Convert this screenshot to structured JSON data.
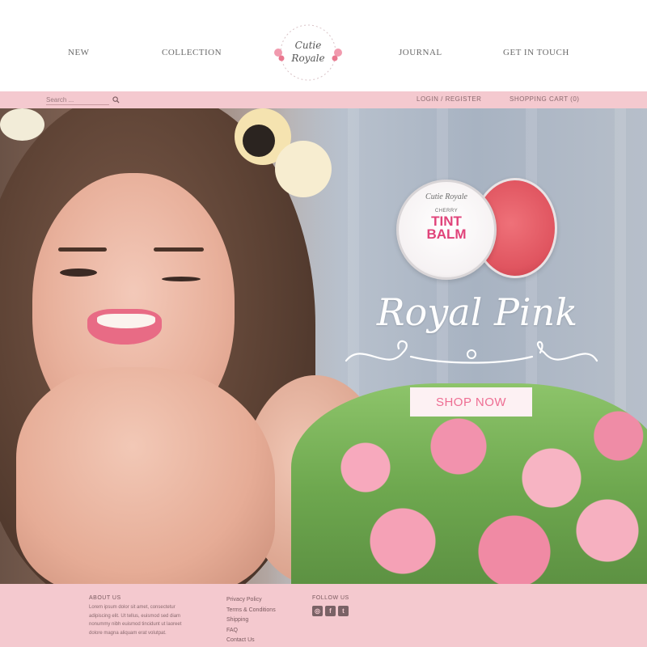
{
  "header": {
    "nav": {
      "new": "NEW",
      "collection": "COLLECTION",
      "journal": "JOURNAL",
      "contact": "GET IN TOUCH"
    },
    "logo_text": "Cutie Royale"
  },
  "utility_bar": {
    "search_placeholder": "Search ...",
    "login": "LOGIN / REGISTER",
    "cart": "SHOPPING CART (0)"
  },
  "hero": {
    "product_brand": "Cutie Royale",
    "product_subtitle": "CHERRY",
    "product_name_line1": "TINT",
    "product_name_line2": "BALM",
    "headline": "Royal Pink",
    "cta": "SHOP NOW"
  },
  "footer": {
    "about_title": "ABOUT US",
    "about_text": "Lorem ipsum dolor sit amet, consectetur adipiscing elit. Ut tellus, euismod sed diam nonummy nibh euismod tincidunt ut laoreet dolore magna aliquam erat volutpat.",
    "links": [
      "Privacy Policy",
      "Terms & Conditions",
      "Shipping",
      "FAQ",
      "Contact Us"
    ],
    "follow_title": "FOLLOW US",
    "social_icons": [
      "instagram-icon",
      "facebook-icon",
      "twitter-icon"
    ]
  },
  "colors": {
    "brand_pink": "#f4c9cf",
    "accent_pink": "#ee6e93",
    "button_bg": "#fdf1f3"
  }
}
